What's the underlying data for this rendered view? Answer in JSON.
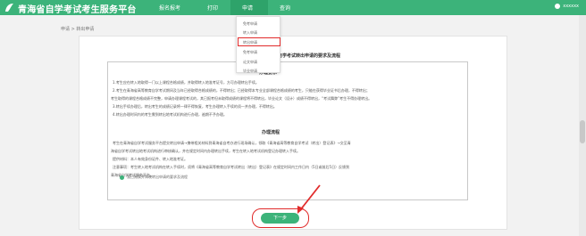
{
  "header": {
    "site_title": "青海省自学考试考生服务平台",
    "nav": [
      "报名报考",
      "打印",
      "申请",
      "查询"
    ],
    "user": "xxxxxx"
  },
  "breadcrumb": "申请 > 转出申请",
  "dropdown": [
    "免考申请",
    "转入申请",
    "转出申请",
    "免考申请",
    "论文申请",
    "毕业申请"
  ],
  "doc": {
    "title": "青海省高等教育自学考试转出申请的要求及流程",
    "req_title": "办理要求",
    "req_lines": [
      "1.考生应在转入地取得一门以上课程合格成绩，并取得转入地准考证号，方可办理转出手续。",
      "2.考生在青海省高等教育自学考试期间及当年已经取得合格成绩的，不得转出；已经取得本专业全部课程合格成绩的考生，只能在获得毕业证书后办理，不得转出；",
      "考生取得的课程合格成绩不完整，申请办理课程考试的，其已报考但未取得成绩的课程将不得转出，毕业论文（设计）成绩不得转出，“考试舞弊”考生不得办理转出。",
      "3.转出手续办理后，转出考生的成绩记录将一律不得恢复，考生办理转入手续的须一并办理，不得转出。",
      "4.转出办理时间内的考生需到转出地考试机构进行办理，逾期不予办理。"
    ],
    "flow_title": "办理流程",
    "flow_lines": [
      "考生在青海省自学考试服务平台提交转出申请→携带相关材料到青海省自考办进行现场确认，领取《青海省高等教育自学考试（转出）登记表》→交至青",
      "海省自学考试转出地考试机构进行审核确认，并在规定时间内办理转出手续，考生在转入地考试机构登记办理转入手续。",
      "提供材料：本人有效身份证件、转入地准考证。",
      "注意事项：考生转入地考试机构在转入手续时，须将《青海省高等教育自学考试转出（转出）登记表》在规定时间内工作日内（5日或前后5日）反馈到",
      "青海省自学考试服务平台。"
    ]
  },
  "agree_label": "我已阅读并知晓转出申请的要求及流程",
  "next_button": "下一步",
  "colors": {
    "brand": "#3cb37a",
    "highlight": "#e12b2b"
  }
}
